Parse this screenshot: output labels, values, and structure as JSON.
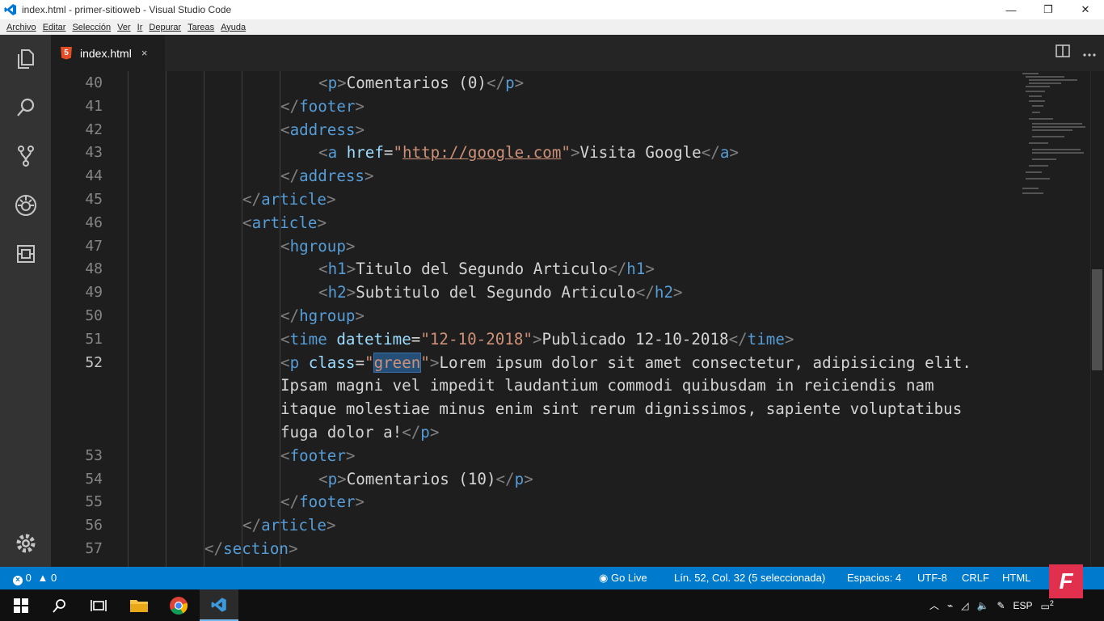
{
  "window": {
    "title": "index.html - primer-sitioweb - Visual Studio Code",
    "minimize_glyph": "—",
    "maximize_glyph": "❐",
    "close_glyph": "✕"
  },
  "menu": [
    "Archivo",
    "Editar",
    "Selección",
    "Ver",
    "Ir",
    "Depurar",
    "Tareas",
    "Ayuda"
  ],
  "activity_icons": [
    "explorer-icon",
    "search-icon",
    "source-control-icon",
    "debug-icon",
    "extensions-icon",
    "settings-gear-icon"
  ],
  "tab": {
    "label": "index.html",
    "close": "×",
    "file_icon": "5"
  },
  "editor": {
    "active_line": "52",
    "lines": [
      {
        "num": "40",
        "indent": 3,
        "tokens": [
          [
            "b",
            "<"
          ],
          [
            "tag",
            "p"
          ],
          [
            "b",
            ">"
          ],
          [
            "txt",
            "Comentarios (0)"
          ],
          [
            "b",
            "</"
          ],
          [
            "tag",
            "p"
          ],
          [
            "b",
            ">"
          ]
        ]
      },
      {
        "num": "41",
        "indent": 2,
        "tokens": [
          [
            "b",
            "</"
          ],
          [
            "tag",
            "footer"
          ],
          [
            "b",
            ">"
          ]
        ]
      },
      {
        "num": "42",
        "indent": 2,
        "tokens": [
          [
            "b",
            "<"
          ],
          [
            "tag",
            "address"
          ],
          [
            "b",
            ">"
          ]
        ]
      },
      {
        "num": "43",
        "indent": 3,
        "tokens": [
          [
            "b",
            "<"
          ],
          [
            "tag",
            "a"
          ],
          [
            "txt",
            " "
          ],
          [
            "attr",
            "href"
          ],
          [
            "txt",
            "="
          ],
          [
            "str",
            "\""
          ],
          [
            "link",
            "http://google.com"
          ],
          [
            "str",
            "\""
          ],
          [
            "b",
            ">"
          ],
          [
            "txt",
            "Visita Google"
          ],
          [
            "b",
            "</"
          ],
          [
            "tag",
            "a"
          ],
          [
            "b",
            ">"
          ]
        ]
      },
      {
        "num": "44",
        "indent": 2,
        "tokens": [
          [
            "b",
            "</"
          ],
          [
            "tag",
            "address"
          ],
          [
            "b",
            ">"
          ]
        ]
      },
      {
        "num": "45",
        "indent": 1,
        "tokens": [
          [
            "b",
            "</"
          ],
          [
            "tag",
            "article"
          ],
          [
            "b",
            ">"
          ]
        ]
      },
      {
        "num": "46",
        "indent": 1,
        "tokens": [
          [
            "b",
            "<"
          ],
          [
            "tag",
            "article"
          ],
          [
            "b",
            ">"
          ]
        ]
      },
      {
        "num": "47",
        "indent": 2,
        "tokens": [
          [
            "b",
            "<"
          ],
          [
            "tag",
            "hgroup"
          ],
          [
            "b",
            ">"
          ]
        ]
      },
      {
        "num": "48",
        "indent": 3,
        "tokens": [
          [
            "b",
            "<"
          ],
          [
            "tag",
            "h1"
          ],
          [
            "b",
            ">"
          ],
          [
            "txt",
            "Titulo del Segundo Articulo"
          ],
          [
            "b",
            "</"
          ],
          [
            "tag",
            "h1"
          ],
          [
            "b",
            ">"
          ]
        ]
      },
      {
        "num": "49",
        "indent": 3,
        "tokens": [
          [
            "b",
            "<"
          ],
          [
            "tag",
            "h2"
          ],
          [
            "b",
            ">"
          ],
          [
            "txt",
            "Subtitulo del Segundo Articulo"
          ],
          [
            "b",
            "</"
          ],
          [
            "tag",
            "h2"
          ],
          [
            "b",
            ">"
          ]
        ]
      },
      {
        "num": "50",
        "indent": 2,
        "tokens": [
          [
            "b",
            "</"
          ],
          [
            "tag",
            "hgroup"
          ],
          [
            "b",
            ">"
          ]
        ]
      },
      {
        "num": "51",
        "indent": 2,
        "tokens": [
          [
            "b",
            "<"
          ],
          [
            "tag",
            "time"
          ],
          [
            "txt",
            " "
          ],
          [
            "attr",
            "datetime"
          ],
          [
            "txt",
            "="
          ],
          [
            "str",
            "\"12-10-2018\""
          ],
          [
            "b",
            ">"
          ],
          [
            "txt",
            "Publicado 12-10-2018"
          ],
          [
            "b",
            "</"
          ],
          [
            "tag",
            "time"
          ],
          [
            "b",
            ">"
          ]
        ]
      },
      {
        "num": "52",
        "indent": 2,
        "tokens": [
          [
            "b",
            "<"
          ],
          [
            "tag",
            "p"
          ],
          [
            "txt",
            " "
          ],
          [
            "attr",
            "class"
          ],
          [
            "txt",
            "="
          ],
          [
            "str",
            "\""
          ],
          [
            "sel",
            "green"
          ],
          [
            "str",
            "\""
          ],
          [
            "b",
            ">"
          ],
          [
            "txt",
            "Lorem ipsum dolor sit amet consectetur, adipisicing elit."
          ]
        ]
      },
      {
        "num": "",
        "indent": 2,
        "tokens": [
          [
            "txt",
            "Ipsam magni vel impedit laudantium commodi quibusdam in reiciendis nam"
          ]
        ]
      },
      {
        "num": "",
        "indent": 2,
        "tokens": [
          [
            "txt",
            "itaque molestiae minus enim sint rerum dignissimos, sapiente voluptatibus"
          ]
        ]
      },
      {
        "num": "",
        "indent": 2,
        "tokens": [
          [
            "txt",
            "fuga dolor a!"
          ],
          [
            "b",
            "</"
          ],
          [
            "tag",
            "p"
          ],
          [
            "b",
            ">"
          ]
        ]
      },
      {
        "num": "53",
        "indent": 2,
        "tokens": [
          [
            "b",
            "<"
          ],
          [
            "tag",
            "footer"
          ],
          [
            "b",
            ">"
          ]
        ]
      },
      {
        "num": "54",
        "indent": 3,
        "tokens": [
          [
            "b",
            "<"
          ],
          [
            "tag",
            "p"
          ],
          [
            "b",
            ">"
          ],
          [
            "txt",
            "Comentarios (10)"
          ],
          [
            "b",
            "</"
          ],
          [
            "tag",
            "p"
          ],
          [
            "b",
            ">"
          ]
        ]
      },
      {
        "num": "55",
        "indent": 2,
        "tokens": [
          [
            "b",
            "</"
          ],
          [
            "tag",
            "footer"
          ],
          [
            "b",
            ">"
          ]
        ]
      },
      {
        "num": "56",
        "indent": 1,
        "tokens": [
          [
            "b",
            "</"
          ],
          [
            "tag",
            "article"
          ],
          [
            "b",
            ">"
          ]
        ]
      },
      {
        "num": "57",
        "indent": 0,
        "tokens": [
          [
            "b",
            "</"
          ],
          [
            "tag",
            "section"
          ],
          [
            "b",
            ">"
          ]
        ]
      }
    ]
  },
  "status": {
    "errors": "0",
    "warnings": "0",
    "go_live": "Go Live",
    "position": "Lín. 52, Col. 32 (5 seleccionada)",
    "spaces": "Espacios: 4",
    "encoding": "UTF-8",
    "eol": "CRLF",
    "language": "HTML"
  },
  "taskbar": {
    "tray_lang": "ESP",
    "notification_count": "2"
  },
  "brand_overlay": "F",
  "colors": {
    "accent": "#007acc",
    "tag": "#569cd6",
    "attr": "#9cdcfe",
    "string": "#ce9178",
    "bracket": "#808080",
    "text": "#d4d4d4"
  }
}
